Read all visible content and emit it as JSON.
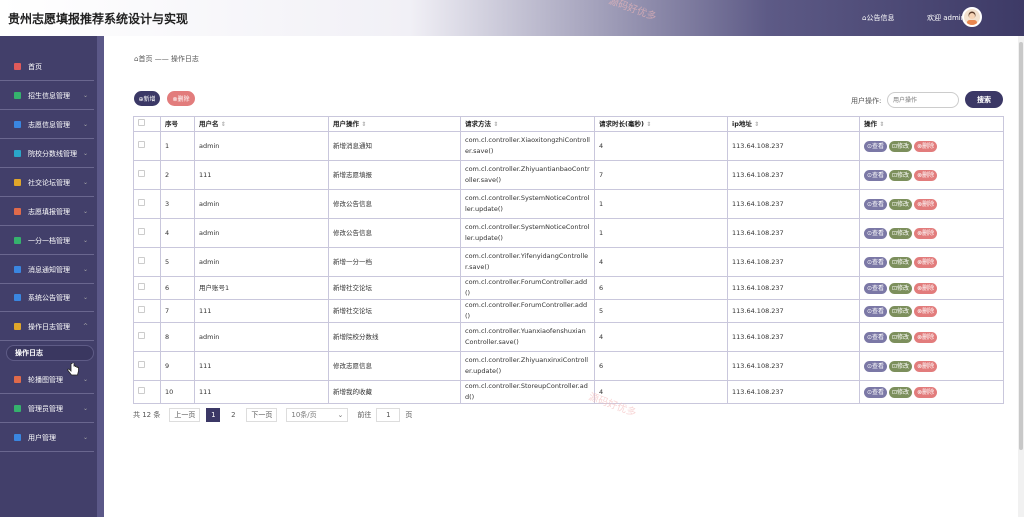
{
  "header": {
    "app_title": "贵州志愿填报推荐系统设计与实现",
    "notice_label": "公告信息",
    "welcome": "欢迎 admin"
  },
  "sidebar": {
    "items": [
      {
        "label": "首页",
        "icon": "home-icon",
        "color": "#e05a5a",
        "chev": ""
      },
      {
        "label": "招生信息管理",
        "icon": "grid-icon",
        "color": "#35b26d",
        "chev": "⌄"
      },
      {
        "label": "志愿信息管理",
        "icon": "grid-icon",
        "color": "#3a86e0",
        "chev": "⌄"
      },
      {
        "label": "院校分数线管理",
        "icon": "grid-icon",
        "color": "#2aa6c9",
        "chev": "⌄"
      },
      {
        "label": "社交论坛管理",
        "icon": "grid-icon",
        "color": "#e0a62a",
        "chev": "⌄"
      },
      {
        "label": "志愿填报管理",
        "icon": "grid-icon",
        "color": "#e06a4a",
        "chev": "⌄"
      },
      {
        "label": "一分一档管理",
        "icon": "grid-icon",
        "color": "#35b26d",
        "chev": "⌄"
      },
      {
        "label": "消息通知管理",
        "icon": "grid-icon",
        "color": "#3a86e0",
        "chev": "⌄"
      },
      {
        "label": "系统公告管理",
        "icon": "grid-icon",
        "color": "#3a86e0",
        "chev": "⌄"
      },
      {
        "label": "操作日志管理",
        "icon": "grid-icon",
        "color": "#e0a62a",
        "chev": "^"
      },
      {
        "label": "轮播图管理",
        "icon": "grid-icon",
        "color": "#e06a4a",
        "chev": "⌄"
      },
      {
        "label": "管理员管理",
        "icon": "user-icon",
        "color": "#35b26d",
        "chev": "⌄"
      },
      {
        "label": "用户管理",
        "icon": "user-icon",
        "color": "#3a86e0",
        "chev": "⌄"
      }
    ],
    "active_sub": "操作日志"
  },
  "breadcrumb": {
    "home": "首页",
    "sep": "——",
    "current": "操作日志"
  },
  "toolbar": {
    "add_label": "⊕新增",
    "delete_label": "⊗删除",
    "search_label": "用户操作:",
    "search_placeholder": "用户操作",
    "search_button": "搜索"
  },
  "table": {
    "columns": [
      "",
      "序号",
      "用户名",
      "用户操作",
      "请求方法",
      "请求时长(毫秒)",
      "ip地址",
      "操作"
    ],
    "sort_indicator": "⇕",
    "rows": [
      {
        "no": "1",
        "user": "admin",
        "action": "新增消息通知",
        "method": "com.cl.controller.XiaoxitongzhiController.save()",
        "duration": "4",
        "ip": "113.64.108.237"
      },
      {
        "no": "2",
        "user": "111",
        "action": "新增志愿填报",
        "method": "com.cl.controller.ZhiyuantianbaoController.save()",
        "duration": "7",
        "ip": "113.64.108.237"
      },
      {
        "no": "3",
        "user": "admin",
        "action": "修改公告信息",
        "method": "com.cl.controller.SystemNoticeController.update()",
        "duration": "1",
        "ip": "113.64.108.237"
      },
      {
        "no": "4",
        "user": "admin",
        "action": "修改公告信息",
        "method": "com.cl.controller.SystemNoticeController.update()",
        "duration": "1",
        "ip": "113.64.108.237"
      },
      {
        "no": "5",
        "user": "admin",
        "action": "新增一分一档",
        "method": "com.cl.controller.YifenyidangController.save()",
        "duration": "4",
        "ip": "113.64.108.237"
      },
      {
        "no": "6",
        "user": "用户账号1",
        "action": "新增社交论坛",
        "method": "com.cl.controller.ForumController.add()",
        "duration": "6",
        "ip": "113.64.108.237"
      },
      {
        "no": "7",
        "user": "111",
        "action": "新增社交论坛",
        "method": "com.cl.controller.ForumController.add()",
        "duration": "5",
        "ip": "113.64.108.237"
      },
      {
        "no": "8",
        "user": "admin",
        "action": "新增院校分数线",
        "method": "com.cl.controller.YuanxiaofenshuxianController.save()",
        "duration": "4",
        "ip": "113.64.108.237"
      },
      {
        "no": "9",
        "user": "111",
        "action": "修改志愿信息",
        "method": "com.cl.controller.ZhiyuanxinxiController.update()",
        "duration": "6",
        "ip": "113.64.108.237"
      },
      {
        "no": "10",
        "user": "111",
        "action": "新增我的收藏",
        "method": "com.cl.controller.StoreupController.add()",
        "duration": "4",
        "ip": "113.64.108.237"
      }
    ],
    "op_view": "⊙查看",
    "op_edit": "⊡修改",
    "op_delete": "⊗删除"
  },
  "pagination": {
    "total": "共 12 条",
    "prev": "上一页",
    "pages": [
      "1",
      "2"
    ],
    "next": "下一页",
    "page_size": "10条/页",
    "goto_label": "前往",
    "goto_value": "1",
    "page_unit": "页"
  },
  "watermark": "源码好优多",
  "colors": {
    "accent": "#3b3866",
    "danger": "#e27c7c",
    "sidebar": "#423f6a",
    "edit": "#7c8f5c"
  }
}
